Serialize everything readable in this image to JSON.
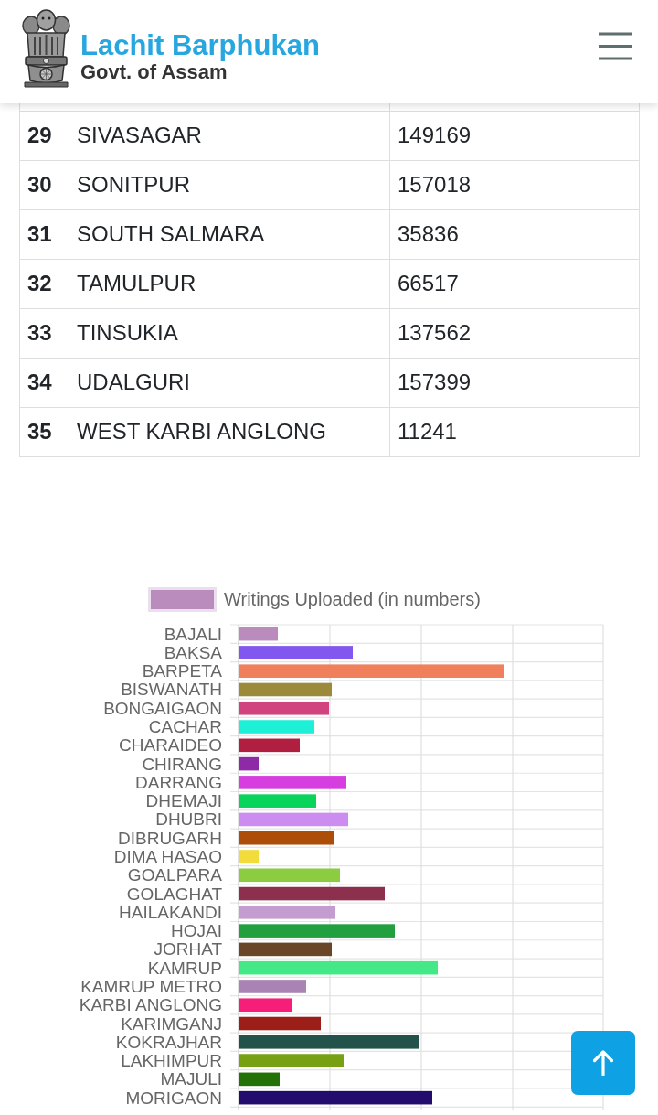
{
  "header": {
    "title": "Lachit Barphukan",
    "subtitle": "Govt. of Assam"
  },
  "table": {
    "rows": [
      {
        "column_1": "29",
        "column_2": "SIVASAGAR",
        "column_3": "149169"
      },
      {
        "column_1": "30",
        "column_2": "SONITPUR",
        "column_3": "157018"
      },
      {
        "column_1": "31",
        "column_2": "SOUTH SALMARA",
        "column_3": "35836"
      },
      {
        "column_1": "32",
        "column_2": "TAMULPUR",
        "column_3": "66517"
      },
      {
        "column_1": "33",
        "column_2": "TINSUKIA",
        "column_3": "137562"
      },
      {
        "column_1": "34",
        "column_2": "UDALGURI",
        "column_3": "157399"
      },
      {
        "column_1": "35",
        "column_2": "WEST KARBI ANGLONG",
        "column_3": "11241"
      }
    ]
  },
  "chart": {
    "legend": "Writings Uploaded (in numbers)",
    "bars": [
      {
        "label": "BAJALI",
        "color": "#b98cbd"
      },
      {
        "label": "BAKSA",
        "color": "#8257f0"
      },
      {
        "label": "BARPETA",
        "color": "#f07f5c"
      },
      {
        "label": "BISWANATH",
        "color": "#9b8a3a"
      },
      {
        "label": "BONGAIGAON",
        "color": "#d1437f"
      },
      {
        "label": "CACHAR",
        "color": "#1ef0d8"
      },
      {
        "label": "CHARAIDEO",
        "color": "#b01f3f"
      },
      {
        "label": "CHIRANG",
        "color": "#8e2aa6"
      },
      {
        "label": "DARRANG",
        "color": "#d63ee0"
      },
      {
        "label": "DHEMAJI",
        "color": "#08d35a"
      },
      {
        "label": "DHUBRI",
        "color": "#cd8cf0"
      },
      {
        "label": "DIBRUGARH",
        "color": "#ad4e08"
      },
      {
        "label": "DIMA HASAO",
        "color": "#f2dc3c"
      },
      {
        "label": "GOALPARA",
        "color": "#8ccc40"
      },
      {
        "label": "GOLAGHAT",
        "color": "#8c304e"
      },
      {
        "label": "HAILAKANDI",
        "color": "#c59ccf"
      },
      {
        "label": "HOJAI",
        "color": "#22a040"
      },
      {
        "label": "JORHAT",
        "color": "#6a4628"
      },
      {
        "label": "KAMRUP",
        "color": "#45e886"
      },
      {
        "label": "KAMRUP METRO",
        "color": "#a983b4"
      },
      {
        "label": "KARBI ANGLONG",
        "color": "#f71e7a"
      },
      {
        "label": "KARIMGANJ",
        "color": "#9b1f18"
      },
      {
        "label": "KOKRAJHAR",
        "color": "#22524a"
      },
      {
        "label": "LAKHIMPUR",
        "color": "#77a012"
      },
      {
        "label": "MAJULI",
        "color": "#247207"
      },
      {
        "label": "MORIGAON",
        "color": "#220d6e"
      }
    ]
  }
}
